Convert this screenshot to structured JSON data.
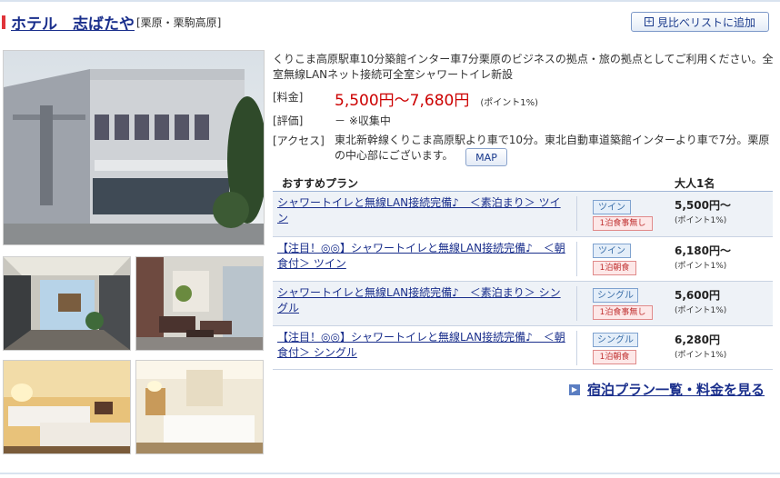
{
  "hotel": {
    "name": "ホテル　志ばたや",
    "area": "[栗原・栗駒高原]",
    "add_button": "見比べリストに追加",
    "description": "くりこま高原駅車10分築館インター車7分栗原のビジネスの拠点・旅の拠点としてご利用ください。全室無線LANネット接続可全室シャワートイレ新設",
    "price_label": "[料金]",
    "price_value": "5,500円〜7,680円",
    "price_point": "(ポイント1%)",
    "rating_label": "[評価]",
    "rating_value": "－ ※収集中",
    "access_label": "[アクセス]",
    "access_value": "東北新幹線くりこま高原駅より車で10分。東北自動車道築館インターより車で7分。栗原の中心部にございます。",
    "map_button": "MAP"
  },
  "plans": {
    "header_plan": "おすすめプラン",
    "header_price": "大人1名",
    "rows": [
      {
        "title": "シャワートイレと無線LAN接続完備♪　＜素泊まり＞ ツイン",
        "room": "ツイン",
        "meal": "1泊食事無し",
        "price": "5,500円〜",
        "point": "(ポイント1%)"
      },
      {
        "title": "【注目！◎◎】シャワートイレと無線LAN接続完備♪　＜朝食付＞ ツイン",
        "room": "ツイン",
        "meal": "1泊朝食",
        "price": "6,180円〜",
        "point": "(ポイント1%)"
      },
      {
        "title": "シャワートイレと無線LAN接続完備♪　＜素泊まり＞ シングル",
        "room": "シングル",
        "meal": "1泊食事無し",
        "price": "5,600円",
        "point": "(ポイント1%)"
      },
      {
        "title": "【注目！◎◎】シャワートイレと無線LAN接続完備♪　＜朝食付＞ シングル",
        "room": "シングル",
        "meal": "1泊朝食",
        "price": "6,280円",
        "point": "(ポイント1%)"
      }
    ]
  },
  "more_link": "宿泊プラン一覧・料金を見る",
  "colors": {
    "link": "#1a2f8c",
    "price": "#cc0000",
    "accent": "#e0343a"
  }
}
